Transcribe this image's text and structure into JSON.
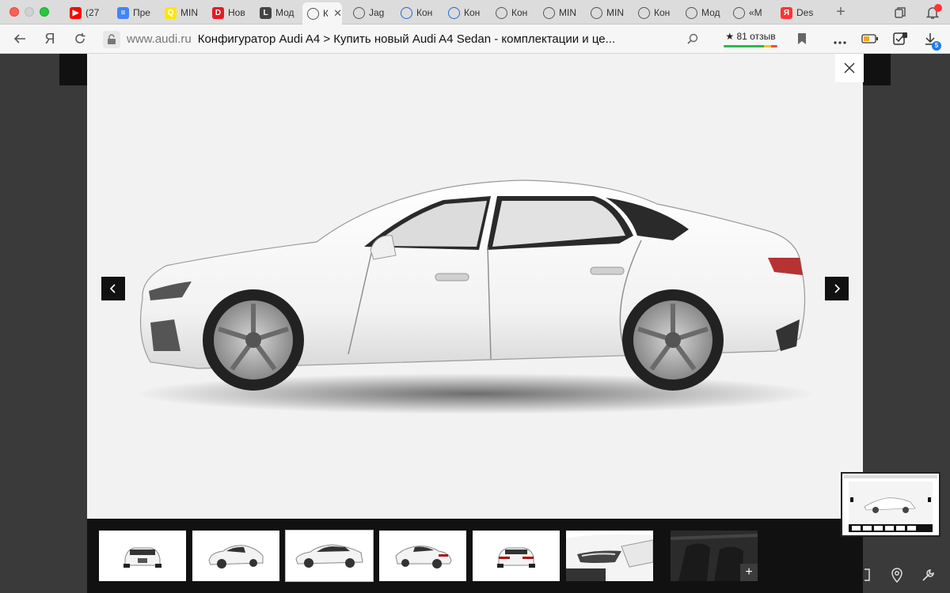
{
  "tabs": [
    {
      "title": "(27",
      "favicon": "youtube-icon",
      "color": "#ff0000",
      "glyph": "▶"
    },
    {
      "title": "Пре",
      "favicon": "docs-icon",
      "color": "#4285f4",
      "glyph": "≡"
    },
    {
      "title": "MIN",
      "favicon": "q-icon",
      "color": "#ffe600",
      "glyph": "Q"
    },
    {
      "title": "Нов",
      "favicon": "d-icon",
      "color": "#e31b23",
      "glyph": "D"
    },
    {
      "title": "Мод",
      "favicon": "lexus-icon",
      "color": "#444444",
      "glyph": "L"
    },
    {
      "title": "К",
      "favicon": "audi-rings-icon",
      "color": "#555555",
      "glyph": "",
      "active": true
    },
    {
      "title": "Jag",
      "favicon": "jaguar-icon",
      "color": "#555555",
      "glyph": ""
    },
    {
      "title": "Кон",
      "favicon": "bmw-icon",
      "color": "#1c69d4",
      "glyph": ""
    },
    {
      "title": "Кон",
      "favicon": "bmw-icon",
      "color": "#1c69d4",
      "glyph": ""
    },
    {
      "title": "Кон",
      "favicon": "wings-icon",
      "color": "#555555",
      "glyph": ""
    },
    {
      "title": "MIN",
      "favicon": "mini-icon",
      "color": "#555555",
      "glyph": ""
    },
    {
      "title": "MIN",
      "favicon": "mini-icon",
      "color": "#555555",
      "glyph": ""
    },
    {
      "title": "Кон",
      "favicon": "mini-icon",
      "color": "#555555",
      "glyph": ""
    },
    {
      "title": "Мод",
      "favicon": "rr-icon",
      "color": "#555555",
      "glyph": ""
    },
    {
      "title": "«М",
      "favicon": "mercedes-icon",
      "color": "#555555",
      "glyph": ""
    },
    {
      "title": "Des",
      "favicon": "yandex-icon",
      "color": "#ff3333",
      "glyph": "Я"
    }
  ],
  "toolbar": {
    "domain": "www.audi.ru",
    "page_title": "Конфигуратор Audi A4 > Купить новый Audi A4 Sedan - комплектации и це...",
    "reviews": "★ 81 отзыв",
    "downloads_badge": "5"
  },
  "viewer": {
    "thumbnails": [
      {
        "view": "front"
      },
      {
        "view": "front-three-quarter"
      },
      {
        "view": "side",
        "selected": true
      },
      {
        "view": "rear-three-quarter"
      },
      {
        "view": "rear"
      },
      {
        "view": "headlight-detail"
      },
      {
        "view": "interior"
      }
    ],
    "plus_label": "+"
  },
  "colors": {
    "page_bg": "#3a3a3a",
    "viewer_bg": "#f2f2f2",
    "strip_bg": "#111111",
    "car_body": "#f7f7f7"
  }
}
